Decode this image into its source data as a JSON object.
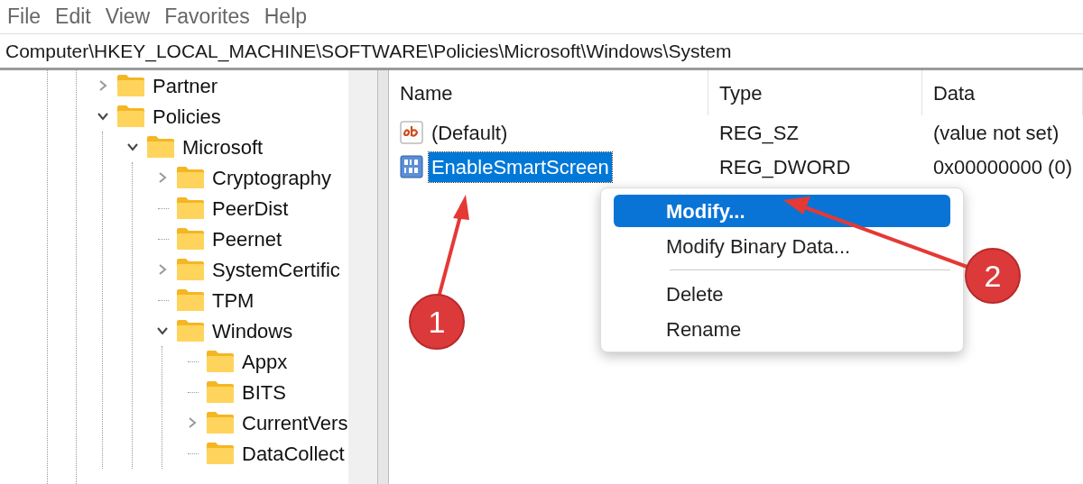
{
  "menu_bar": [
    "File",
    "Edit",
    "View",
    "Favorites",
    "Help"
  ],
  "address_bar": {
    "value": "Computer\\HKEY_LOCAL_MACHINE\\SOFTWARE\\Policies\\Microsoft\\Windows\\System"
  },
  "tree": [
    {
      "label": "Partner",
      "kind": "branch",
      "expanded": false
    },
    {
      "label": "Policies",
      "kind": "branch",
      "expanded": true,
      "children": [
        {
          "label": "Microsoft",
          "kind": "branch",
          "expanded": true,
          "children": [
            {
              "label": "Cryptography",
              "kind": "branch",
              "expanded": false
            },
            {
              "label": "PeerDist",
              "kind": "leaf"
            },
            {
              "label": "Peernet",
              "kind": "leaf"
            },
            {
              "label": "SystemCertific",
              "kind": "branch",
              "expanded": false
            },
            {
              "label": "TPM",
              "kind": "leaf"
            },
            {
              "label": "Windows",
              "kind": "branch",
              "expanded": true,
              "children": [
                {
                  "label": "Appx",
                  "kind": "leaf"
                },
                {
                  "label": "BITS",
                  "kind": "leaf"
                },
                {
                  "label": "CurrentVers",
                  "kind": "branch",
                  "expanded": false
                },
                {
                  "label": "DataCollect",
                  "kind": "leaf"
                }
              ]
            }
          ]
        }
      ]
    }
  ],
  "table": {
    "columns": [
      "Name",
      "Type",
      "Data"
    ],
    "rows": [
      {
        "kind": "string",
        "name": "(Default)",
        "type": "REG_SZ",
        "data": "(value not set)",
        "selected": false
      },
      {
        "kind": "binary",
        "name": "EnableSmartScreen",
        "type": "REG_DWORD",
        "data": "0x00000000 (0)",
        "selected": true
      }
    ]
  },
  "context_menu": [
    {
      "kind": "item",
      "label": "Modify...",
      "selected": true
    },
    {
      "kind": "item",
      "label": "Modify Binary Data...",
      "selected": false
    },
    {
      "kind": "separator"
    },
    {
      "kind": "item",
      "label": "Delete",
      "selected": false
    },
    {
      "kind": "item",
      "label": "Rename",
      "selected": false
    }
  ],
  "annotations": [
    {
      "label": "1"
    },
    {
      "label": "2"
    }
  ]
}
